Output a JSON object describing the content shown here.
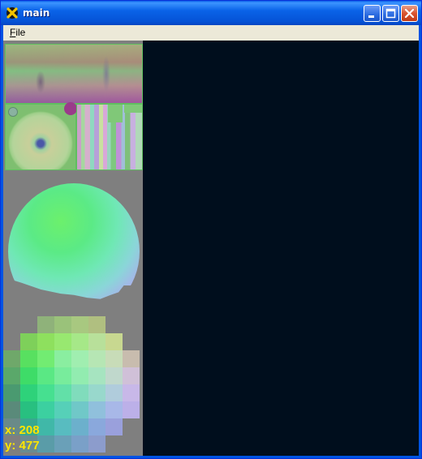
{
  "window": {
    "title": "main",
    "icon": "app-x-icon"
  },
  "title_buttons": {
    "minimize": "minimize-icon",
    "maximize": "maximize-icon",
    "close": "close-icon"
  },
  "menu": {
    "items": [
      {
        "label": "File",
        "mnemonic": "F"
      }
    ]
  },
  "cursor": {
    "x_label": "x: 208",
    "y_label": "y: 477"
  },
  "colors": {
    "client_bg": "#000e1d",
    "sidebar_bg": "#7f7f7f",
    "readout": "#ffe500"
  }
}
